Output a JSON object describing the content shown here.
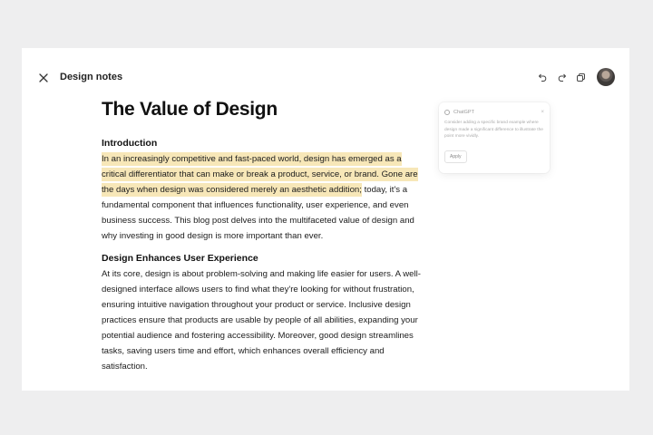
{
  "header": {
    "title": "Design notes"
  },
  "document": {
    "title": "The Value of Design",
    "sections": [
      {
        "heading": "Introduction",
        "highlighted_text": "In an increasingly competitive and fast-paced world, design has emerged as a critical differentiator that can make or break a product, service, or brand. Gone are the days when design was considered merely an aesthetic addition;",
        "text": " today, it's a fundamental component that influences functionality, user experience, and even business success. This blog post delves into the multifaceted value of design and why investing in good design is more important than ever."
      },
      {
        "heading": "Design Enhances User Experience",
        "text": "At its core, design is about problem-solving and making life easier for users. A well-designed interface allows users to find what they're looking for without frustration, ensuring intuitive navigation throughout your product or service. Inclusive design practices ensure that products are usable by people of all abilities, expanding your potential audience and fostering accessibility. Moreover, good design streamlines tasks, saving users time and effort, which enhances overall efficiency and satisfaction."
      }
    ]
  },
  "suggestion": {
    "source": "ChatGPT",
    "close_glyph": "×",
    "text": "Consider adding a specific brand example where design made a significant difference to illustrate the point more vividly.",
    "apply_label": "Apply"
  },
  "colors": {
    "highlight": "#f7e7b8",
    "background": "#eeeeef"
  },
  "icons": [
    "close-icon",
    "undo-icon",
    "redo-icon",
    "copy-icon"
  ]
}
